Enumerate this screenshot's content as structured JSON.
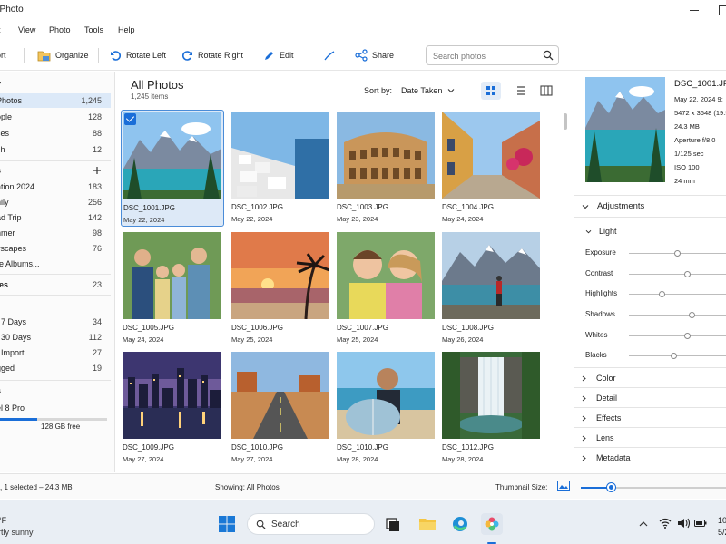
{
  "window": {
    "title": "ePhoto"
  },
  "menu": [
    "t",
    "View",
    "Photo",
    "Tools",
    "Help"
  ],
  "toolbar": {
    "import_label": "ort",
    "organize_label": "Organize",
    "rotate_left_label": "Rotate Left",
    "rotate_right_label": "Rotate Right",
    "edit_label": "Edit",
    "share_label": "Share",
    "search_placeholder": "Search photos",
    "icons": [
      "folder-icon",
      "rotate-left-icon",
      "rotate-right-icon",
      "pencil-icon",
      "crop-icon",
      "share-icon",
      "search-icon"
    ]
  },
  "sidebar": {
    "library": {
      "title": "y",
      "items": [
        {
          "label": "Photos",
          "count": "1,245"
        },
        {
          "label": "ople",
          "count": "128"
        },
        {
          "label": "ces",
          "count": "88"
        },
        {
          "label": "sh",
          "count": "12"
        }
      ]
    },
    "albums": {
      "title": "s",
      "items": [
        {
          "label": "ation 2024",
          "count": "183"
        },
        {
          "label": "nily",
          "count": "256"
        },
        {
          "label": "ad Trip",
          "count": "142"
        },
        {
          "label": "nmer",
          "count": "98"
        },
        {
          "label": "yscapes",
          "count": "76"
        },
        {
          "label": "re Albums...",
          "count": ""
        }
      ]
    },
    "favorites": {
      "label": "tes",
      "count": "23"
    },
    "recent": {
      "title": "t",
      "items": [
        {
          "label": "t 7 Days",
          "count": "34"
        },
        {
          "label": "t 30 Days",
          "count": "112"
        },
        {
          "label": "t Import",
          "count": "27"
        },
        {
          "label": "gged",
          "count": "19"
        }
      ]
    },
    "devices": {
      "title": "s",
      "device_name": "el 8 Pro",
      "free_label": "128 GB free",
      "used_fraction": 0.35
    }
  },
  "main": {
    "title": "All Photos",
    "count_label": "1,245 items",
    "sort_label": "Sort by:",
    "sort_value": "Date Taken",
    "photos": [
      {
        "name": "DSC_1001.JPG",
        "date": "May 22, 2024",
        "scene": "mountain-lake",
        "selected": true
      },
      {
        "name": "DSC_1002.JPG",
        "date": "May 22, 2024",
        "scene": "seaside-village",
        "selected": false
      },
      {
        "name": "DSC_1003.JPG",
        "date": "May 23, 2024",
        "scene": "colosseum",
        "selected": false
      },
      {
        "name": "DSC_1004.JPG",
        "date": "May 24, 2024",
        "scene": "old-street",
        "selected": false
      },
      {
        "name": "DSC_1005.JPG",
        "date": "May 24, 2024",
        "scene": "family",
        "selected": false
      },
      {
        "name": "DSC_1006.JPG",
        "date": "May 25, 2024",
        "scene": "sunset-beach",
        "selected": false
      },
      {
        "name": "DSC_1007.JPG",
        "date": "May 25, 2024",
        "scene": "kids",
        "selected": false
      },
      {
        "name": "DSC_1008.JPG",
        "date": "May 26, 2024",
        "scene": "hiker-lake",
        "selected": false
      },
      {
        "name": "DSC_1009.JPG",
        "date": "May 27, 2024",
        "scene": "city-night",
        "selected": false
      },
      {
        "name": "DSC_1010.JPG",
        "date": "May 27, 2024",
        "scene": "desert-road",
        "selected": false
      },
      {
        "name": "DSC_1010.JPG",
        "date": "May 28, 2024",
        "scene": "boy-surfboard",
        "selected": false
      },
      {
        "name": "DSC_1012.JPG",
        "date": "May 28, 2024",
        "scene": "waterfall",
        "selected": false
      }
    ]
  },
  "details": {
    "name": "DSC_1001.JPG",
    "date": "May 22, 2024  9:",
    "dimensions": "5472 x 3648 (19.9",
    "size": "24.3 MB",
    "aperture": "Aperture f/8.0",
    "shutter": "1/125 sec",
    "iso": "ISO 100",
    "focal": "24 mm"
  },
  "adjustments": {
    "title": "Adjustments",
    "light_title": "Light",
    "sliders": [
      {
        "label": "Exposure",
        "value": 0.45
      },
      {
        "label": "Contrast",
        "value": 0.55
      },
      {
        "label": "Highlights",
        "value": 0.3
      },
      {
        "label": "Shadows",
        "value": 0.6
      },
      {
        "label": "Whites",
        "value": 0.55
      },
      {
        "label": "Blacks",
        "value": 0.42
      }
    ],
    "sections": [
      "Color",
      "Detail",
      "Effects",
      "Lens",
      "Metadata"
    ]
  },
  "status": {
    "left": "s, 1 selected – 24.3 MB",
    "middle": "Showing: All Photos",
    "thumb_size_label": "Thumbnail Size:",
    "thumb_size_value": 0.2
  },
  "taskbar": {
    "weather_temp": "°F",
    "weather_desc": "rtly sunny",
    "search_label": "Search",
    "clock_time": "10",
    "clock_date": "5/2"
  },
  "colors": {
    "accent": "#1a6ed8",
    "selection": "#dce9f8"
  }
}
